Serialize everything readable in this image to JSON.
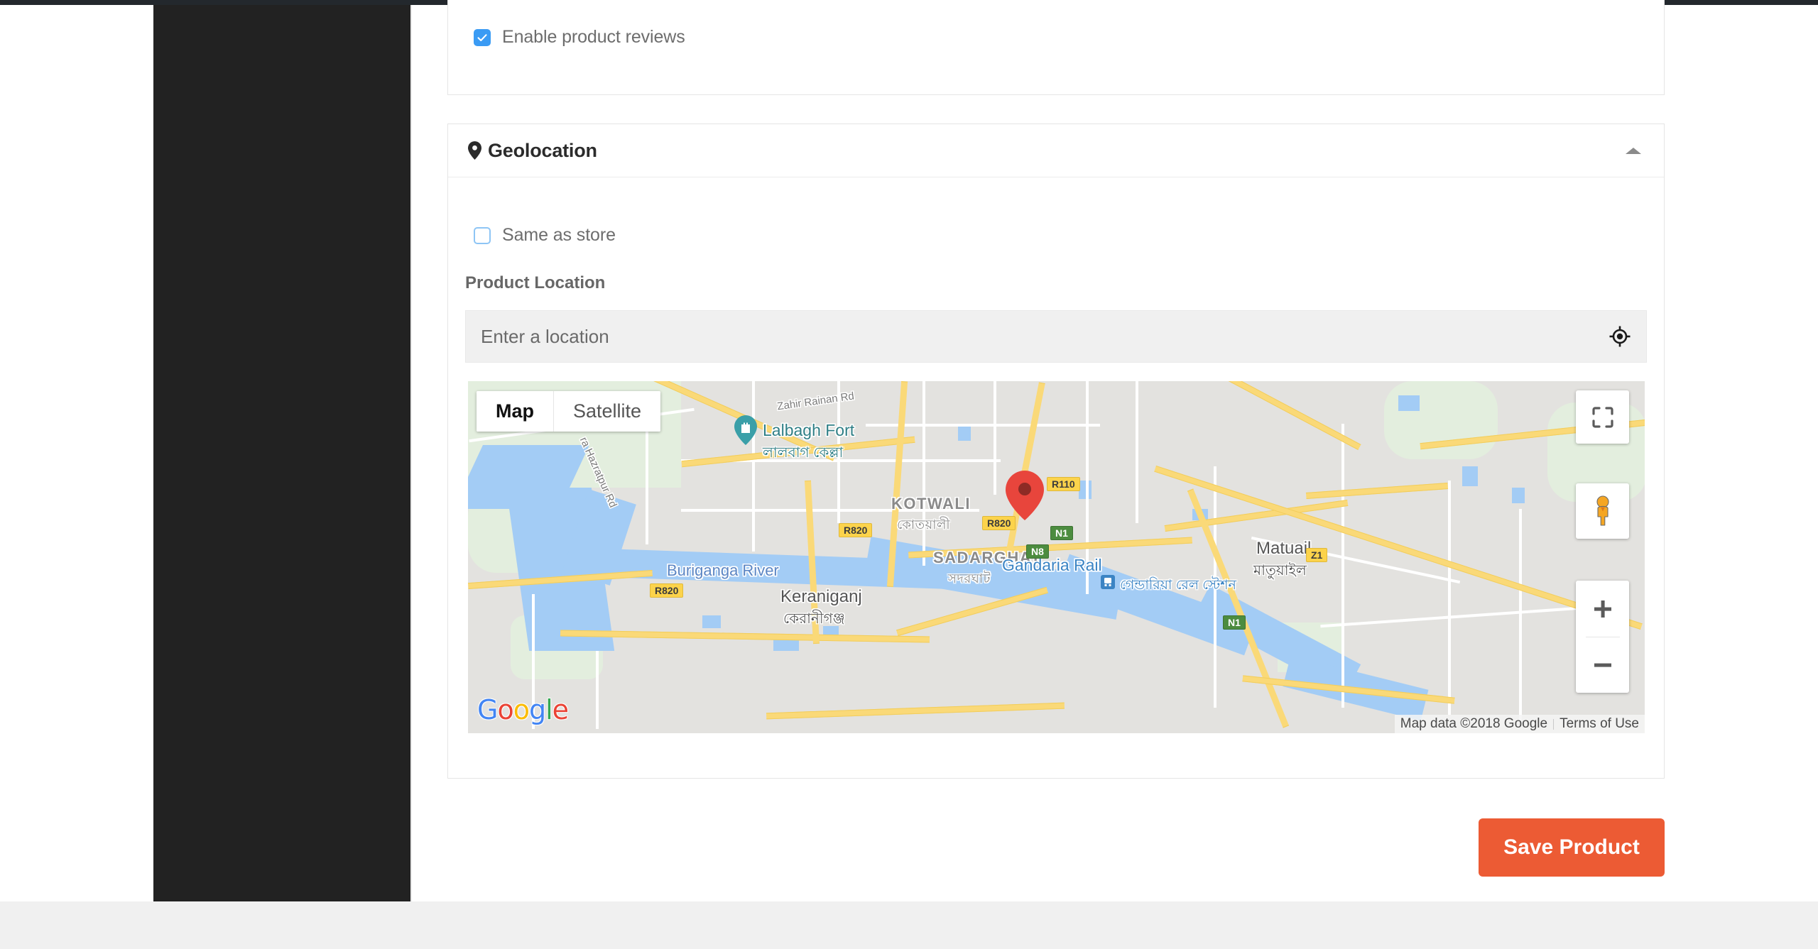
{
  "chrome": {
    "admin_bar_color": "#23282d",
    "sidebar_color": "#222222",
    "footer_color": "#f0f0f0"
  },
  "reviews_card": {
    "checkbox_label": "Enable product reviews",
    "checked": true
  },
  "geolocation_card": {
    "title": "Geolocation",
    "pin_icon": "map-pin-icon",
    "collapse_icon": "caret-up-icon",
    "same_as_store": {
      "label": "Same as store",
      "checked": false
    },
    "product_location": {
      "label": "Product Location",
      "placeholder": "Enter a location",
      "value": "",
      "locate_icon": "my-location-crosshair-icon"
    }
  },
  "map": {
    "type_toggle": {
      "map_label": "Map",
      "satellite_label": "Satellite",
      "active": "Map"
    },
    "controls": {
      "fullscreen": "fullscreen-icon",
      "street_view": "pegman-icon",
      "zoom_in": "plus-icon",
      "zoom_out": "minus-icon"
    },
    "logo": {
      "letters": [
        "G",
        "o",
        "o",
        "g",
        "l",
        "e"
      ]
    },
    "attribution": {
      "data": "Map data ©2018 Google",
      "terms": "Terms of Use"
    },
    "marker": {
      "color": "#e8453c"
    },
    "labels": {
      "poi": [
        {
          "name": "Lalbagh Fort",
          "name_bn": "লালবাগ কেল্লা",
          "type": "monument"
        }
      ],
      "places": [
        {
          "name": "Keraniganj",
          "name_bn": "কেরানীগঞ্জ"
        },
        {
          "name": "Matuail",
          "name_bn": "মাতুয়াইল"
        }
      ],
      "areas": [
        {
          "name": "KOTWALI",
          "name_bn": "কোতয়ালী"
        },
        {
          "name": "SADARGHAT",
          "name_bn": "সদরঘাট"
        }
      ],
      "water": [
        {
          "name": "Buriganga River"
        }
      ],
      "transit": [
        {
          "name": "Gandaria Rail",
          "name_bn": "গেন্ডারিয়া রেল স্টেশন"
        }
      ],
      "roads": [
        {
          "name": "Zahir Rainan Rd"
        },
        {
          "name": "ra Hazratpur Rd"
        }
      ],
      "shields": [
        {
          "label": "R820",
          "kind": "regional"
        },
        {
          "label": "R820",
          "kind": "regional"
        },
        {
          "label": "R820",
          "kind": "regional"
        },
        {
          "label": "R110",
          "kind": "regional"
        },
        {
          "label": "Z1",
          "kind": "regional"
        },
        {
          "label": "N8",
          "kind": "national"
        },
        {
          "label": "N1",
          "kind": "national"
        },
        {
          "label": "N1",
          "kind": "national"
        }
      ]
    }
  },
  "actions": {
    "save_label": "Save Product",
    "save_color": "#ec5b34"
  }
}
